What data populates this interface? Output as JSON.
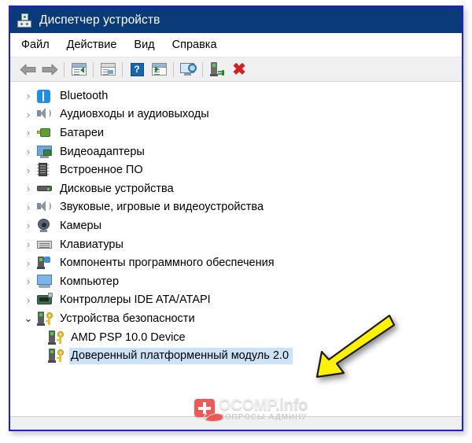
{
  "window": {
    "title": "Диспетчер устройств",
    "title_icon": "device-manager-icon"
  },
  "menu": {
    "items": [
      {
        "label": "Файл",
        "name": "menu-file"
      },
      {
        "label": "Действие",
        "name": "menu-action"
      },
      {
        "label": "Вид",
        "name": "menu-view"
      },
      {
        "label": "Справка",
        "name": "menu-help"
      }
    ]
  },
  "toolbar": {
    "buttons": [
      {
        "name": "back-arrow-icon",
        "tip": "Назад"
      },
      {
        "name": "forward-arrow-icon",
        "tip": "Вперед"
      },
      {
        "name": "properties-window-icon",
        "tip": "Свойства"
      },
      {
        "name": "document-window-icon",
        "tip": "Обновить конфигурацию"
      },
      {
        "name": "help-question-icon",
        "tip": "Справка",
        "glyph": "?"
      },
      {
        "name": "play-window-icon",
        "tip": "Выполнить"
      },
      {
        "name": "scan-monitor-icon",
        "tip": "Обновить конфигурацию оборудования"
      },
      {
        "name": "enable-device-icon",
        "tip": "Включить устройство"
      },
      {
        "name": "delete-device-icon",
        "tip": "Удалить устройство",
        "glyph": "✖"
      }
    ]
  },
  "tree": {
    "items": [
      {
        "label": "Bluetooth",
        "icon": "bluetooth-icon",
        "state": "collapsed",
        "chevron": "›",
        "level": 0
      },
      {
        "label": "Аудиовходы и аудиовыходы",
        "icon": "audio-speaker-icon",
        "state": "collapsed",
        "chevron": "›",
        "level": 0
      },
      {
        "label": "Батареи",
        "icon": "battery-icon",
        "state": "collapsed",
        "chevron": "›",
        "level": 0
      },
      {
        "label": "Видеоадаптеры",
        "icon": "display-adapter-icon",
        "state": "collapsed",
        "chevron": "›",
        "level": 0
      },
      {
        "label": "Встроенное ПО",
        "icon": "firmware-chip-icon",
        "state": "collapsed",
        "chevron": "›",
        "level": 0
      },
      {
        "label": "Дисковые устройства",
        "icon": "disk-drive-icon",
        "state": "collapsed",
        "chevron": "›",
        "level": 0
      },
      {
        "label": "Звуковые, игровые и видеоустройства",
        "icon": "audio-speaker-icon",
        "state": "collapsed",
        "chevron": "›",
        "level": 0
      },
      {
        "label": "Камеры",
        "icon": "camera-icon",
        "state": "collapsed",
        "chevron": "›",
        "level": 0
      },
      {
        "label": "Клавиатуры",
        "icon": "keyboard-icon",
        "state": "collapsed",
        "chevron": "›",
        "level": 0
      },
      {
        "label": "Компоненты программного обеспечения",
        "icon": "software-component-icon",
        "state": "collapsed",
        "chevron": "›",
        "level": 0
      },
      {
        "label": "Компьютер",
        "icon": "computer-icon",
        "state": "collapsed",
        "chevron": "›",
        "level": 0
      },
      {
        "label": "Контроллеры IDE ATA/ATAPI",
        "icon": "ide-controller-icon",
        "state": "collapsed",
        "chevron": "›",
        "level": 0
      },
      {
        "label": "Устройства безопасности",
        "icon": "security-device-icon",
        "state": "expanded",
        "chevron": "⌄",
        "level": 0
      },
      {
        "label": "AMD PSP 10.0 Device",
        "icon": "security-device-icon",
        "state": "leaf",
        "chevron": "",
        "level": 1
      },
      {
        "label": "Доверенный платформенный модуль 2.0",
        "icon": "security-device-icon",
        "state": "leaf-selected",
        "chevron": "",
        "level": 1
      }
    ],
    "selected_index": 14
  },
  "annotation": {
    "arrow_color": "#fff200",
    "arrow_name": "yellow-pointer-arrow",
    "points_to": "Доверенный платформенный модуль 2.0"
  },
  "watermark": {
    "brand": "OCOMP",
    "tld": ".info",
    "tagline": "ВОПРОСЫ АДМИНУ"
  },
  "colors": {
    "titlebar": "#0a3a77",
    "window_border": "#2222cc",
    "selection": "#cce3f7",
    "accent_yellow": "#fff200",
    "accent_red": "#d32020"
  }
}
